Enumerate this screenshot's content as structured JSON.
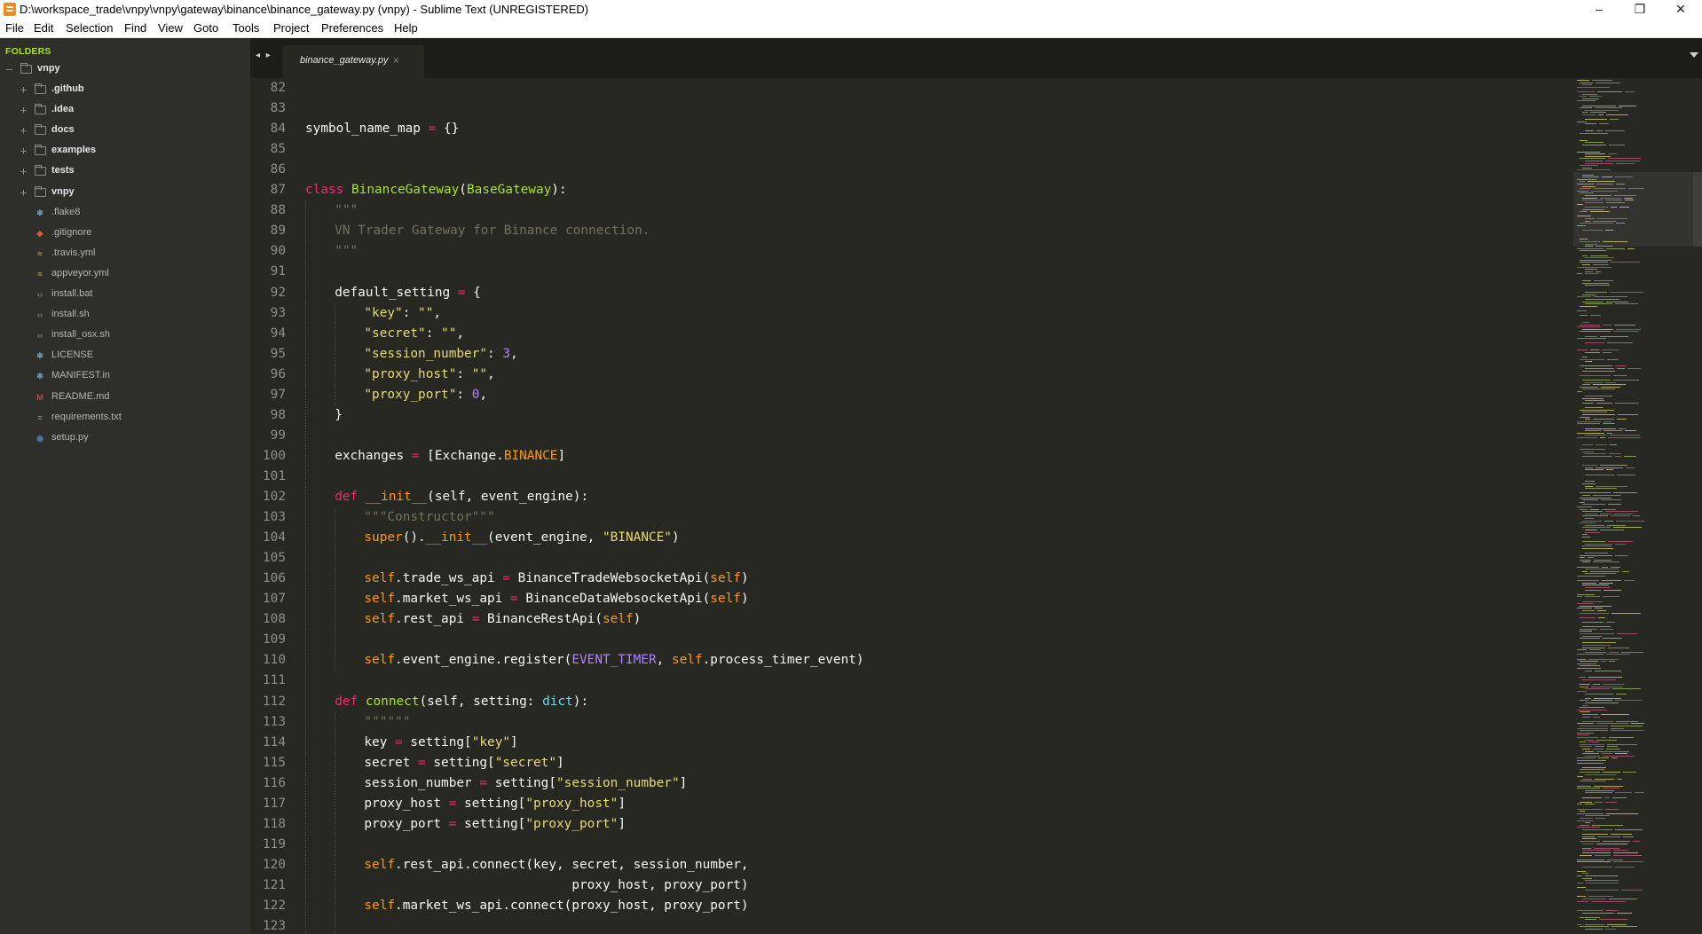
{
  "window": {
    "title": "D:\\workspace_trade\\vnpy\\vnpy\\gateway\\binance\\binance_gateway.py (vnpy) - Sublime Text (UNREGISTERED)",
    "controls": {
      "minimize": "–",
      "maximize": "❐",
      "close": "✕"
    }
  },
  "menubar": {
    "items": [
      "File",
      "Edit",
      "Selection",
      "Find",
      "View",
      "Goto",
      "Tools",
      "Project",
      "Preferences",
      "Help"
    ]
  },
  "sidebar": {
    "heading": "FOLDERS",
    "root": "vnpy",
    "folders": [
      ".github",
      ".idea",
      "docs",
      "examples",
      "tests",
      "vnpy"
    ],
    "files": [
      {
        "name": ".flake8",
        "icon": "gear-icon",
        "color": "#6aa6c8"
      },
      {
        "name": ".gitignore",
        "icon": "git-icon",
        "color": "#e0572a"
      },
      {
        "name": ".travis.yml",
        "icon": "yaml-icon",
        "color": "#c8a64a"
      },
      {
        "name": "appveyor.yml",
        "icon": "yaml-icon",
        "color": "#c8a64a"
      },
      {
        "name": "install.bat",
        "icon": "code-icon",
        "color": "#8a8a8a"
      },
      {
        "name": "install.sh",
        "icon": "code-icon",
        "color": "#8a8a8a"
      },
      {
        "name": "install_osx.sh",
        "icon": "code-icon",
        "color": "#8a8a8a"
      },
      {
        "name": "LICENSE",
        "icon": "gear-icon",
        "color": "#6aa6c8"
      },
      {
        "name": "MANIFEST.in",
        "icon": "gear-icon",
        "color": "#6aa6c8"
      },
      {
        "name": "README.md",
        "icon": "markdown-icon",
        "color": "#b04a4a"
      },
      {
        "name": "requirements.txt",
        "icon": "text-icon",
        "color": "#8a8a8a"
      },
      {
        "name": "setup.py",
        "icon": "python-icon",
        "color": "#4a7ab0"
      }
    ]
  },
  "tabs": {
    "nav": "◂ ▸",
    "active": {
      "label": "binance_gateway.py",
      "close": "×"
    }
  },
  "editor": {
    "lines": [
      {
        "n": "82",
        "indent": 0,
        "tokens": []
      },
      {
        "n": "83",
        "indent": 0,
        "tokens": []
      },
      {
        "n": "84",
        "indent": 0,
        "tokens": [
          [
            "",
            "symbol_name_map "
          ],
          [
            "kw",
            "="
          ],
          [
            "",
            " {}"
          ]
        ]
      },
      {
        "n": "85",
        "indent": 0,
        "tokens": []
      },
      {
        "n": "86",
        "indent": 0,
        "tokens": []
      },
      {
        "n": "87",
        "indent": 0,
        "tokens": [
          [
            "kw",
            "class"
          ],
          [
            "",
            " "
          ],
          [
            "cls",
            "BinanceGateway"
          ],
          [
            "",
            "("
          ],
          [
            "cls",
            "BaseGateway"
          ],
          [
            "",
            "):"
          ]
        ]
      },
      {
        "n": "88",
        "indent": 1,
        "tokens": [
          [
            "cm",
            "\"\"\""
          ]
        ]
      },
      {
        "n": "89",
        "indent": 1,
        "tokens": [
          [
            "cm",
            "VN Trader Gateway for Binance connection."
          ]
        ]
      },
      {
        "n": "90",
        "indent": 1,
        "tokens": [
          [
            "cm",
            "\"\"\""
          ]
        ]
      },
      {
        "n": "91",
        "indent": 1,
        "tokens": []
      },
      {
        "n": "92",
        "indent": 1,
        "tokens": [
          [
            "",
            "default_setting "
          ],
          [
            "kw",
            "="
          ],
          [
            "",
            " {"
          ]
        ]
      },
      {
        "n": "93",
        "indent": 2,
        "tokens": [
          [
            "str",
            "\"key\""
          ],
          [
            "",
            ": "
          ],
          [
            "str",
            "\"\""
          ],
          [
            "",
            ","
          ]
        ]
      },
      {
        "n": "94",
        "indent": 2,
        "tokens": [
          [
            "str",
            "\"secret\""
          ],
          [
            "",
            ": "
          ],
          [
            "str",
            "\"\""
          ],
          [
            "",
            ","
          ]
        ]
      },
      {
        "n": "95",
        "indent": 2,
        "tokens": [
          [
            "str",
            "\"session_number\""
          ],
          [
            "",
            ": "
          ],
          [
            "num",
            "3"
          ],
          [
            "",
            ","
          ]
        ]
      },
      {
        "n": "96",
        "indent": 2,
        "tokens": [
          [
            "str",
            "\"proxy_host\""
          ],
          [
            "",
            ": "
          ],
          [
            "str",
            "\"\""
          ],
          [
            "",
            ","
          ]
        ]
      },
      {
        "n": "97",
        "indent": 2,
        "tokens": [
          [
            "str",
            "\"proxy_port\""
          ],
          [
            "",
            ": "
          ],
          [
            "num",
            "0"
          ],
          [
            "",
            ","
          ]
        ]
      },
      {
        "n": "98",
        "indent": 1,
        "tokens": [
          [
            "",
            "}"
          ]
        ]
      },
      {
        "n": "99",
        "indent": 1,
        "tokens": []
      },
      {
        "n": "100",
        "indent": 1,
        "tokens": [
          [
            "",
            "exchanges "
          ],
          [
            "kw",
            "="
          ],
          [
            "",
            " [Exchange."
          ],
          [
            "sf",
            "BINANCE"
          ],
          [
            "",
            "]"
          ]
        ]
      },
      {
        "n": "101",
        "indent": 1,
        "tokens": []
      },
      {
        "n": "102",
        "indent": 1,
        "tokens": [
          [
            "kw",
            "def"
          ],
          [
            "",
            " "
          ],
          [
            "mg",
            "__init__"
          ],
          [
            "",
            "(self, event_engine):"
          ]
        ]
      },
      {
        "n": "103",
        "indent": 2,
        "tokens": [
          [
            "cm",
            "\"\"\"Constructor\"\"\""
          ]
        ]
      },
      {
        "n": "104",
        "indent": 2,
        "tokens": [
          [
            "sf",
            "super"
          ],
          [
            "",
            "()."
          ],
          [
            "mg",
            "__init__"
          ],
          [
            "",
            "(event_engine, "
          ],
          [
            "str",
            "\"BINANCE\""
          ],
          [
            "",
            ")"
          ]
        ]
      },
      {
        "n": "105",
        "indent": 2,
        "tokens": []
      },
      {
        "n": "106",
        "indent": 2,
        "tokens": [
          [
            "sf",
            "self"
          ],
          [
            "",
            ".trade_ws_api "
          ],
          [
            "kw",
            "="
          ],
          [
            "",
            " BinanceTradeWebsocketApi("
          ],
          [
            "sf",
            "self"
          ],
          [
            "",
            ")"
          ]
        ]
      },
      {
        "n": "107",
        "indent": 2,
        "tokens": [
          [
            "sf",
            "self"
          ],
          [
            "",
            ".market_ws_api "
          ],
          [
            "kw",
            "="
          ],
          [
            "",
            " BinanceDataWebsocketApi("
          ],
          [
            "sf",
            "self"
          ],
          [
            "",
            ")"
          ]
        ]
      },
      {
        "n": "108",
        "indent": 2,
        "tokens": [
          [
            "sf",
            "self"
          ],
          [
            "",
            ".rest_api "
          ],
          [
            "kw",
            "="
          ],
          [
            "",
            " BinanceRestApi("
          ],
          [
            "sf",
            "self"
          ],
          [
            "",
            ")"
          ]
        ]
      },
      {
        "n": "109",
        "indent": 2,
        "tokens": []
      },
      {
        "n": "110",
        "indent": 2,
        "tokens": [
          [
            "sf",
            "self"
          ],
          [
            "",
            ".event_engine.register("
          ],
          [
            "cst",
            "EVENT_TIMER"
          ],
          [
            "",
            ", "
          ],
          [
            "sf",
            "self"
          ],
          [
            "",
            ".process_timer_event)"
          ]
        ]
      },
      {
        "n": "111",
        "indent": 1,
        "tokens": []
      },
      {
        "n": "112",
        "indent": 1,
        "tokens": [
          [
            "kw",
            "def"
          ],
          [
            "",
            " "
          ],
          [
            "fn",
            "connect"
          ],
          [
            "",
            "(self, setting: "
          ],
          [
            "bi",
            "dict"
          ],
          [
            "",
            "):"
          ]
        ]
      },
      {
        "n": "113",
        "indent": 2,
        "tokens": [
          [
            "cm",
            "\"\"\"\"\"\""
          ]
        ]
      },
      {
        "n": "114",
        "indent": 2,
        "tokens": [
          [
            "",
            "key "
          ],
          [
            "kw",
            "="
          ],
          [
            "",
            " setting["
          ],
          [
            "str",
            "\"key\""
          ],
          [
            "",
            "]"
          ]
        ]
      },
      {
        "n": "115",
        "indent": 2,
        "tokens": [
          [
            "",
            "secret "
          ],
          [
            "kw",
            "="
          ],
          [
            "",
            " setting["
          ],
          [
            "str",
            "\"secret\""
          ],
          [
            "",
            "]"
          ]
        ]
      },
      {
        "n": "116",
        "indent": 2,
        "tokens": [
          [
            "",
            "session_number "
          ],
          [
            "kw",
            "="
          ],
          [
            "",
            " setting["
          ],
          [
            "str",
            "\"session_number\""
          ],
          [
            "",
            "]"
          ]
        ]
      },
      {
        "n": "117",
        "indent": 2,
        "tokens": [
          [
            "",
            "proxy_host "
          ],
          [
            "kw",
            "="
          ],
          [
            "",
            " setting["
          ],
          [
            "str",
            "\"proxy_host\""
          ],
          [
            "",
            "]"
          ]
        ]
      },
      {
        "n": "118",
        "indent": 2,
        "tokens": [
          [
            "",
            "proxy_port "
          ],
          [
            "kw",
            "="
          ],
          [
            "",
            " setting["
          ],
          [
            "str",
            "\"proxy_port\""
          ],
          [
            "",
            "]"
          ]
        ]
      },
      {
        "n": "119",
        "indent": 2,
        "tokens": []
      },
      {
        "n": "120",
        "indent": 2,
        "tokens": [
          [
            "sf",
            "self"
          ],
          [
            "",
            ".rest_api.connect(key, secret, session_number,"
          ]
        ]
      },
      {
        "n": "121",
        "indent": 2,
        "tokens": [
          [
            "",
            "                           proxy_host, proxy_port)"
          ]
        ]
      },
      {
        "n": "122",
        "indent": 2,
        "tokens": [
          [
            "sf",
            "self"
          ],
          [
            "",
            ".market_ws_api.connect(proxy_host, proxy_port)"
          ]
        ]
      },
      {
        "n": "123",
        "indent": 2,
        "tokens": []
      }
    ]
  },
  "colors": {
    "background": "#272822",
    "sidebar": "#2e2e2b",
    "keyword": "#f92672",
    "class_name": "#a6e22e",
    "string": "#e6db74",
    "number": "#ae81ff",
    "comment": "#75715e",
    "builtin": "#66d9ef",
    "self": "#fd971f"
  }
}
